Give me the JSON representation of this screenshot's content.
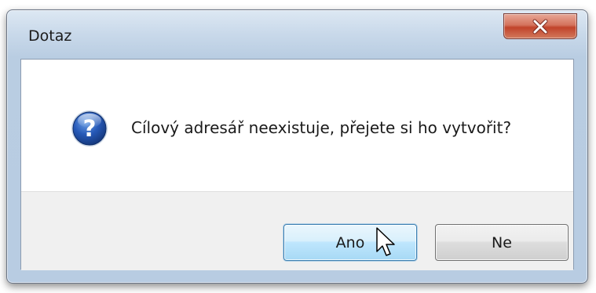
{
  "dialog": {
    "title": "Dotaz",
    "message": "Cílový adresář neexistuje, přejete si ho vytvořit?",
    "icon": "question-icon",
    "close_icon": "close-icon",
    "buttons": {
      "yes_label": "Ano",
      "no_label": "Ne"
    }
  },
  "colors": {
    "frame": "#b9cde2",
    "close_button": "#c1432b",
    "question_icon": "#1f4fa3",
    "default_button_border": "#3c7fb1"
  },
  "cursor": {
    "icon": "pointer-cursor-icon",
    "hovering": "yes-button"
  }
}
